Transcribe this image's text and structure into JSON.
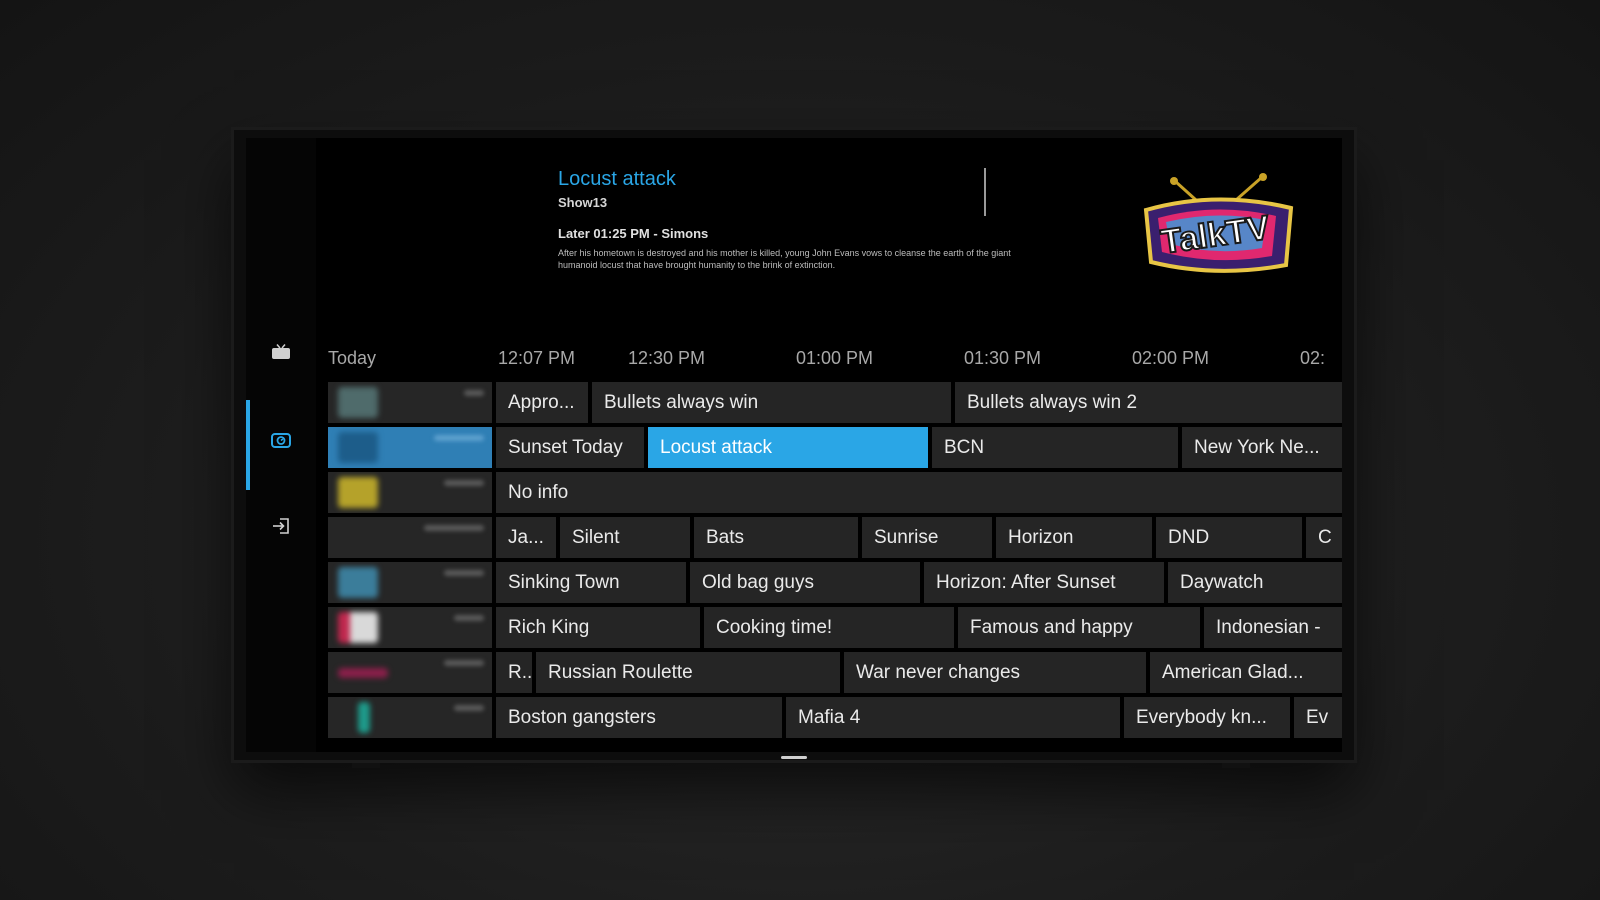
{
  "info": {
    "title": "Locust attack",
    "subtitle": "Show13",
    "later": "Later 01:25 PM - Simons",
    "description": "After his hometown is destroyed and his mother is killed, young John Evans vows to cleanse the earth of the giant humanoid locust that have brought humanity to the brink of extinction."
  },
  "nav": {
    "items": [
      {
        "icon": "tv-icon"
      },
      {
        "icon": "guide-icon",
        "active": true
      },
      {
        "icon": "login-icon"
      }
    ]
  },
  "logo_text": "TalkTV",
  "guide": {
    "day_label": "Today",
    "times": [
      "12:07 PM",
      "12:30 PM",
      "01:00 PM",
      "01:30 PM",
      "02:00 PM",
      "02:"
    ],
    "rows": [
      {
        "programs": [
          "Appro...",
          "Bullets always win",
          "Bullets always win 2"
        ]
      },
      {
        "programs": [
          "Sunset Today",
          "Locust attack",
          "BCN",
          "New York Ne..."
        ],
        "selected": true
      },
      {
        "programs": [
          "No info"
        ]
      },
      {
        "programs": [
          "Ja...",
          "Silent",
          "Bats",
          "Sunrise",
          "Horizon",
          "DND",
          "C"
        ]
      },
      {
        "programs": [
          "Sinking Town",
          "Old bag guys",
          "Horizon: After Sunset",
          "Daywatch"
        ]
      },
      {
        "programs": [
          "Rich King",
          "Cooking time!",
          "Famous and happy",
          "Indonesian -"
        ]
      },
      {
        "programs": [
          "R...",
          "Russian Roulette",
          "War never changes",
          "American Glad..."
        ]
      },
      {
        "programs": [
          "Boston gangsters",
          "Mafia 4",
          "Everybody kn...",
          "Ev"
        ]
      }
    ]
  },
  "colors": {
    "accent": "#2aa6e6",
    "cell": "#252525",
    "background": "#000000"
  }
}
